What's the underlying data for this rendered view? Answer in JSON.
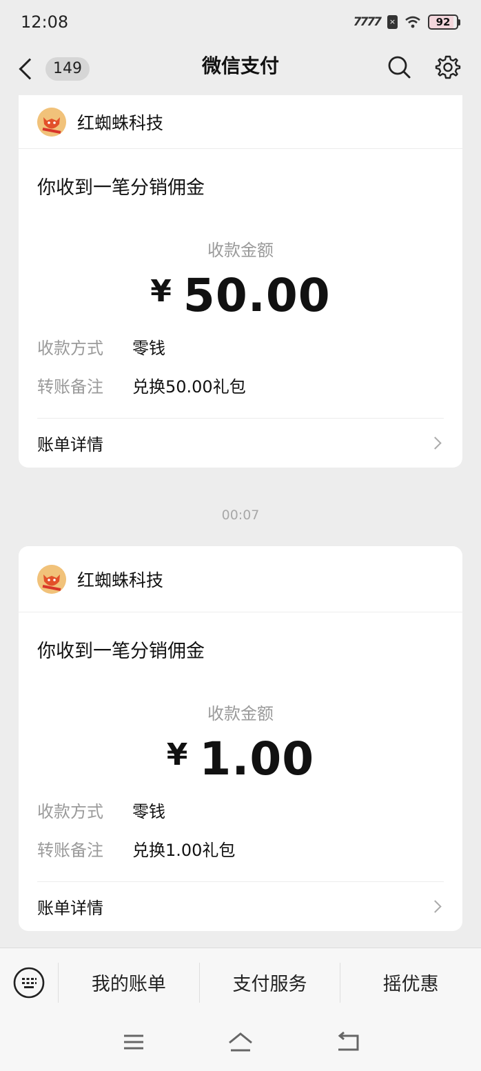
{
  "status_bar": {
    "time": "12:08",
    "signal": "7777",
    "sim": "×",
    "battery": "92"
  },
  "nav": {
    "unread_count": "149",
    "title": "微信支付"
  },
  "messages": [
    {
      "merchant": "红蜘蛛科技",
      "title": "你收到一笔分销佣金",
      "amount_caption": "收款金额",
      "currency": "¥",
      "amount": "50.00",
      "method_label": "收款方式",
      "method_value": "零钱",
      "remark_label": "转账备注",
      "remark_value": "兑换50.00礼包",
      "bill_label": "账单详情"
    },
    {
      "merchant": "红蜘蛛科技",
      "title": "你收到一笔分销佣金",
      "amount_caption": "收款金额",
      "currency": "¥",
      "amount": "1.00",
      "method_label": "收款方式",
      "method_value": "零钱",
      "remark_label": "转账备注",
      "remark_value": "兑换1.00礼包",
      "bill_label": "账单详情"
    }
  ],
  "timestamp": "00:07",
  "bottom_menu": {
    "items": [
      "我的账单",
      "支付服务",
      "摇优惠"
    ]
  },
  "colors": {
    "background": "#ededed",
    "card": "#ffffff",
    "muted_text": "#9a9a9a",
    "logo": "#f1c27a"
  },
  "icons": {
    "back": "chevron-left-icon",
    "search": "search-icon",
    "settings": "gear-icon",
    "keyboard": "keyboard-icon",
    "android_menu": "menu-icon",
    "android_home": "home-icon",
    "android_back": "back-icon"
  }
}
